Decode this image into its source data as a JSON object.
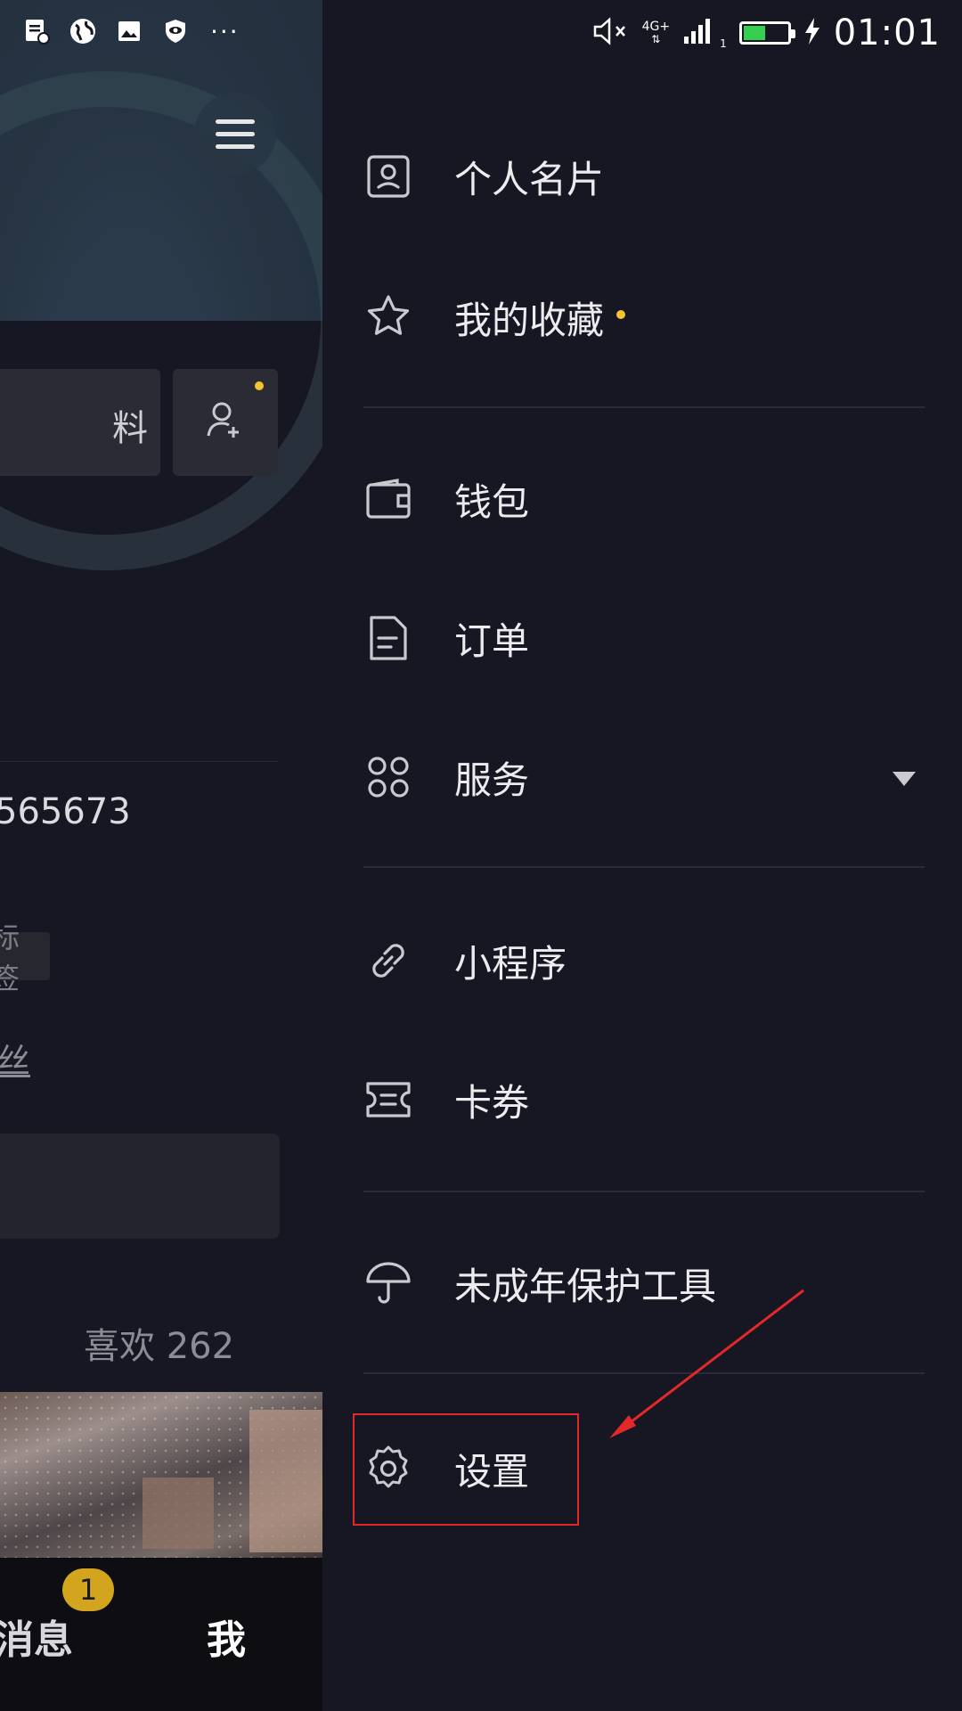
{
  "status_bar": {
    "network": "4G+",
    "signal_sub": "1",
    "battery_level": 0.5,
    "time": "01:01"
  },
  "profile": {
    "edit_button_label": "料",
    "id_text": "565673",
    "tag_label": "标签",
    "fans_label": "丝",
    "likes_label": "喜欢 262",
    "nav_messages": "消息",
    "nav_me": "我",
    "messages_badge": "1"
  },
  "drawer": {
    "items": [
      {
        "label": "个人名片",
        "icon": "contact-card-icon"
      },
      {
        "label": "我的收藏",
        "icon": "star-icon",
        "has_dot": true
      },
      {
        "label": "钱包",
        "icon": "wallet-icon"
      },
      {
        "label": "订单",
        "icon": "order-document-icon"
      },
      {
        "label": "服务",
        "icon": "apps-grid-icon",
        "expandable": true
      },
      {
        "label": "小程序",
        "icon": "link-icon"
      },
      {
        "label": "卡券",
        "icon": "ticket-icon"
      },
      {
        "label": "未成年保护工具",
        "icon": "umbrella-icon"
      },
      {
        "label": "设置",
        "icon": "gear-icon",
        "highlighted": true
      }
    ]
  },
  "colors": {
    "background": "#161722",
    "accent_dot": "#f2c432",
    "highlight": "#e3282b",
    "battery": "#35d04f"
  }
}
